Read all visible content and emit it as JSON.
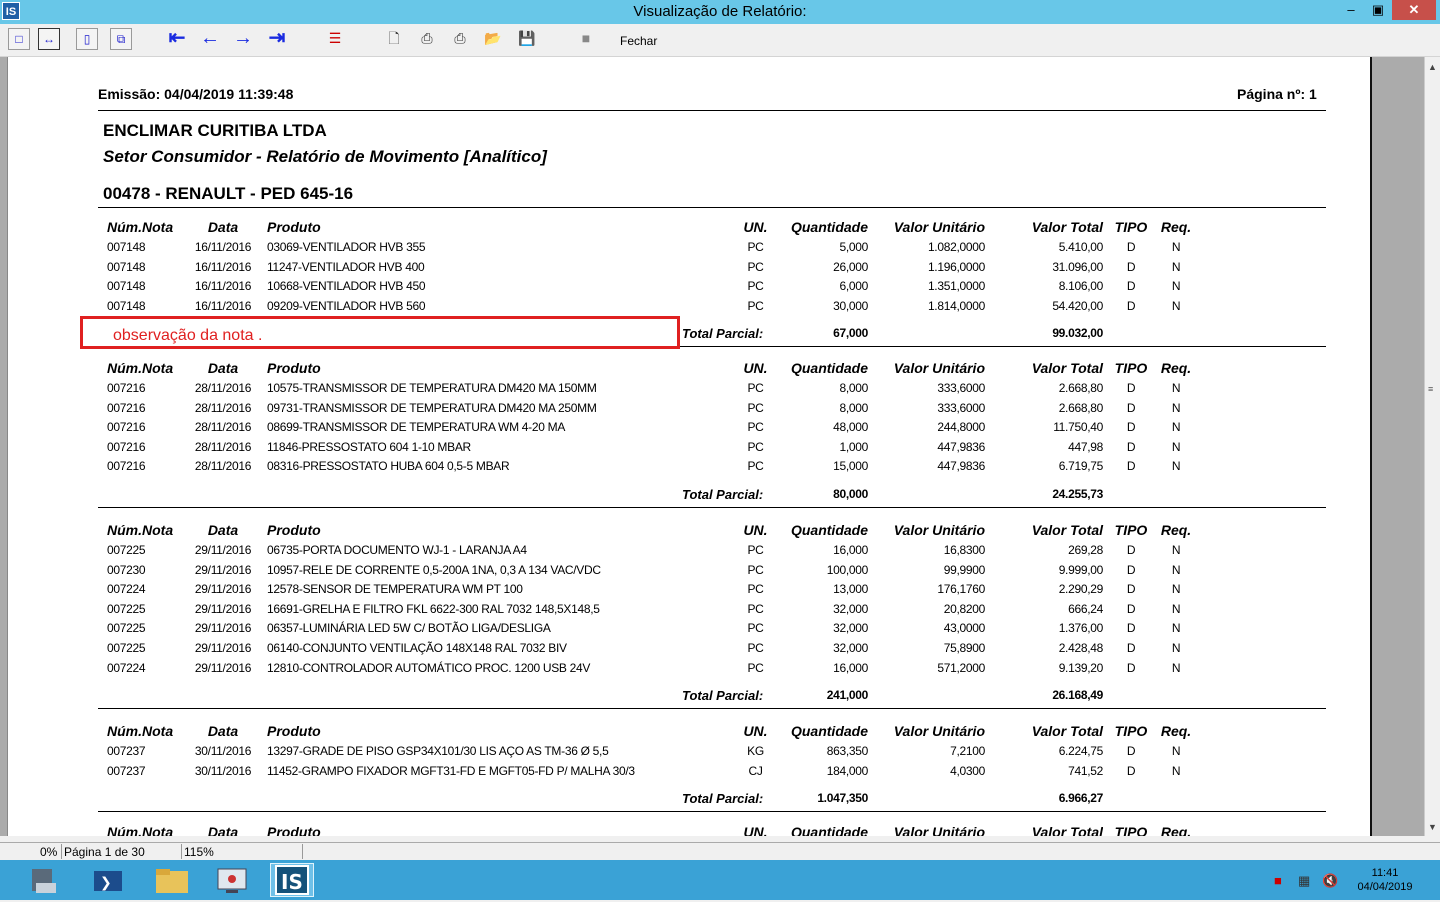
{
  "window": {
    "title": "Visualização de Relatório:",
    "app_icon": "IS",
    "minimize": "–",
    "maximize": "▣",
    "close": "✕"
  },
  "toolbar": {
    "fechar_label": "Fechar"
  },
  "report": {
    "emissao": "Emissão: 04/04/2019 11:39:48",
    "pagina": "Página nº: 1",
    "company": "ENCLIMAR CURITIBA LTDA",
    "subtitle": "Setor Consumidor - Relatório de Movimento [Analítico]",
    "client": "00478 - RENAULT - PED 645-16",
    "columns": {
      "nota": "Núm.Nota",
      "data": "Data",
      "produto": "Produto",
      "un": "UN.",
      "qtd": "Quantidade",
      "vu": "Valor Unitário",
      "vt": "Valor Total",
      "tipo": "TIPO",
      "req": "Req."
    },
    "total_label": "Total Parcial:",
    "groups": [
      {
        "rows": [
          [
            "007148",
            "16/11/2016",
            "03069-VENTILADOR HVB 355",
            "PC",
            "5,000",
            "1.082,0000",
            "5.410,00",
            "D",
            "N"
          ],
          [
            "007148",
            "16/11/2016",
            "11247-VENTILADOR HVB 400",
            "PC",
            "26,000",
            "1.196,0000",
            "31.096,00",
            "D",
            "N"
          ],
          [
            "007148",
            "16/11/2016",
            "10668-VENTILADOR HVB 450",
            "PC",
            "6,000",
            "1.351,0000",
            "8.106,00",
            "D",
            "N"
          ],
          [
            "007148",
            "16/11/2016",
            "09209-VENTILADOR HVB 560",
            "PC",
            "30,000",
            "1.814,0000",
            "54.420,00",
            "D",
            "N"
          ]
        ],
        "total_qtd": "67,000",
        "total_val": "99.032,00"
      },
      {
        "rows": [
          [
            "007216",
            "28/11/2016",
            "10575-TRANSMISSOR DE TEMPERATURA DM420 MA 150MM",
            "PC",
            "8,000",
            "333,6000",
            "2.668,80",
            "D",
            "N"
          ],
          [
            "007216",
            "28/11/2016",
            "09731-TRANSMISSOR DE TEMPERATURA DM420 MA 250MM",
            "PC",
            "8,000",
            "333,6000",
            "2.668,80",
            "D",
            "N"
          ],
          [
            "007216",
            "28/11/2016",
            "08699-TRANSMISSOR DE TEMPERATURA WM 4-20 MA",
            "PC",
            "48,000",
            "244,8000",
            "11.750,40",
            "D",
            "N"
          ],
          [
            "007216",
            "28/11/2016",
            "11846-PRESSOSTATO 604 1-10 MBAR",
            "PC",
            "1,000",
            "447,9836",
            "447,98",
            "D",
            "N"
          ],
          [
            "007216",
            "28/11/2016",
            "08316-PRESSOSTATO HUBA 604 0,5-5 MBAR",
            "PC",
            "15,000",
            "447,9836",
            "6.719,75",
            "D",
            "N"
          ]
        ],
        "total_qtd": "80,000",
        "total_val": "24.255,73"
      },
      {
        "rows": [
          [
            "007225",
            "29/11/2016",
            "06735-PORTA DOCUMENTO WJ-1 - LARANJA A4",
            "PC",
            "16,000",
            "16,8300",
            "269,28",
            "D",
            "N"
          ],
          [
            "007230",
            "29/11/2016",
            "10957-RELE DE CORRENTE 0,5-200A 1NA, 0,3 A 134 VAC/VDC",
            "PC",
            "100,000",
            "99,9900",
            "9.999,00",
            "D",
            "N"
          ],
          [
            "007224",
            "29/11/2016",
            "12578-SENSOR DE TEMPERATURA WM PT 100",
            "PC",
            "13,000",
            "176,1760",
            "2.290,29",
            "D",
            "N"
          ],
          [
            "007225",
            "29/11/2016",
            "16691-GRELHA E FILTRO FKL 6622-300 RAL 7032 148,5X148,5",
            "PC",
            "32,000",
            "20,8200",
            "666,24",
            "D",
            "N"
          ],
          [
            "007225",
            "29/11/2016",
            "06357-LUMINÁRIA LED 5W C/ BOTÃO LIGA/DESLIGA",
            "PC",
            "32,000",
            "43,0000",
            "1.376,00",
            "D",
            "N"
          ],
          [
            "007225",
            "29/11/2016",
            "06140-CONJUNTO VENTILAÇÃO 148X148 RAL 7032 BIV",
            "PC",
            "32,000",
            "75,8900",
            "2.428,48",
            "D",
            "N"
          ],
          [
            "007224",
            "29/11/2016",
            "12810-CONTROLADOR AUTOMÁTICO PROC. 1200 USB 24V",
            "PC",
            "16,000",
            "571,2000",
            "9.139,20",
            "D",
            "N"
          ]
        ],
        "total_qtd": "241,000",
        "total_val": "26.168,49"
      },
      {
        "rows": [
          [
            "007237",
            "30/11/2016",
            "13297-GRADE DE PISO GSP34X101/30 LIS AÇO AS TM-36 Ø 5,5",
            "KG",
            "863,350",
            "7,2100",
            "6.224,75",
            "D",
            "N"
          ],
          [
            "007237",
            "30/11/2016",
            "11452-GRAMPO FIXADOR MGFT31-FD E MGFT05-FD P/ MALHA 30/3",
            "CJ",
            "184,000",
            "4,0300",
            "741,52",
            "D",
            "N"
          ]
        ],
        "total_qtd": "1.047,350",
        "total_val": "6.966,27"
      }
    ]
  },
  "annotation": {
    "text": "observação da nota .",
    "color": "#e02020"
  },
  "statusbar": {
    "progress": "0%",
    "page": "Página 1 de 30",
    "zoom": "115%"
  },
  "taskbar": {
    "time": "11:41",
    "date": "04/04/2019",
    "active_app": "IS"
  }
}
